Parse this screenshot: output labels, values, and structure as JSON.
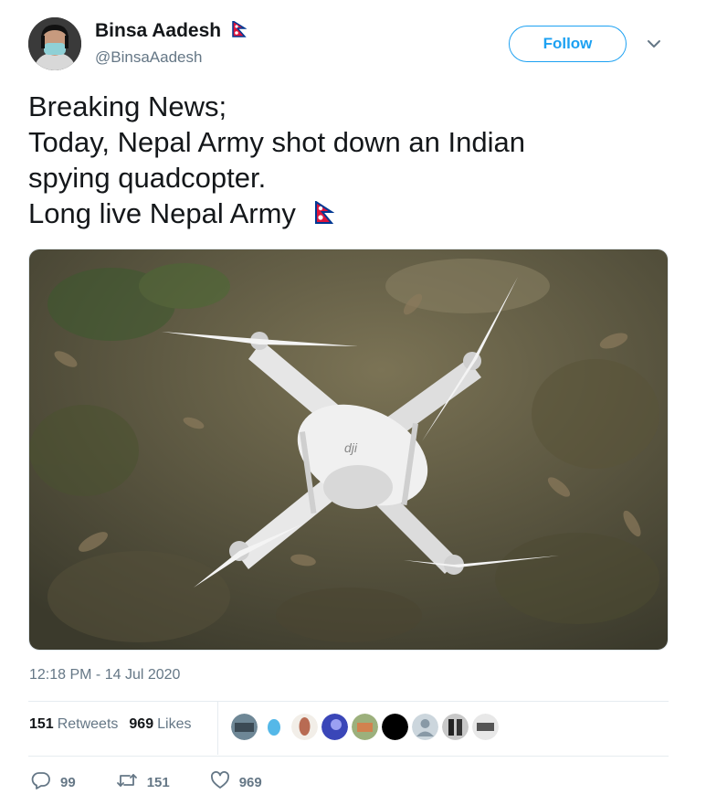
{
  "user": {
    "display_name": "Binsa Aadesh",
    "handle": "@BinsaAadesh",
    "avatar_icon": "avatar-masked-woman",
    "flag_icon": "nepal-flag-icon"
  },
  "follow_label": "Follow",
  "tweet": {
    "lines": [
      "Breaking News;",
      "Today, Nepal Army shot down an Indian",
      "spying quadcopter.",
      "Long live Nepal Army"
    ],
    "photo": "white quadcopter drone lying on dry leaves and grass",
    "drone_brand": "dji",
    "timestamp": "12:18 PM - 14 Jul 2020"
  },
  "stats": {
    "retweets_count": "151",
    "retweets_label": "Retweets",
    "likes_count": "969",
    "likes_label": "Likes",
    "liker_avatars": 9
  },
  "actions": {
    "reply_count": "99",
    "retweet_count": "151",
    "like_count": "969"
  },
  "colors": {
    "accent": "#1da1f2",
    "text": "#14171a",
    "muted": "#657786",
    "divider": "#e6ecf0",
    "flag_red": "#dc143c",
    "flag_blue": "#003893"
  }
}
